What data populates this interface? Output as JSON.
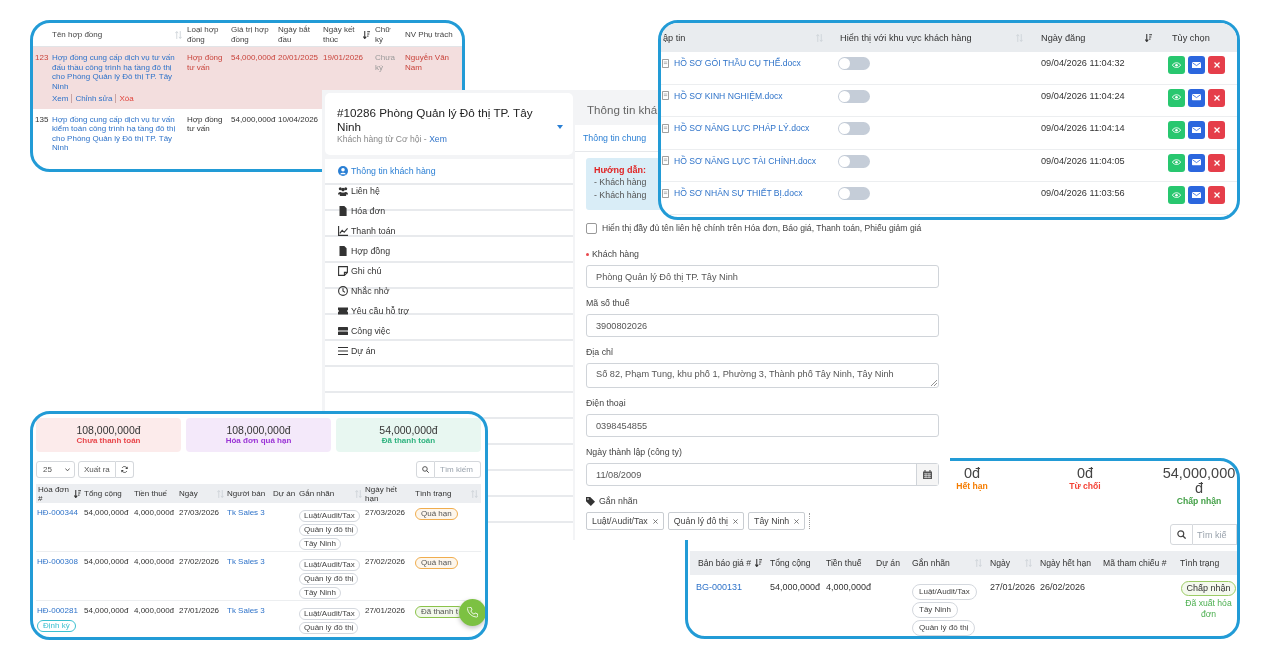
{
  "contracts_card": {
    "columns": [
      {
        "label": "Tên hợp đồng",
        "sortable": true,
        "sorted": false
      },
      {
        "label": "Loại hợp đồng",
        "sortable": false,
        "sorted": false
      },
      {
        "label": "Giá trị hợp đồng",
        "sortable": false,
        "sorted": false
      },
      {
        "label": "Ngày bắt đầu",
        "sortable": false,
        "sorted": false
      },
      {
        "label": "Ngày kết thúc",
        "sortable": true,
        "sorted": true
      },
      {
        "label": "Chữ ký",
        "sortable": false,
        "sorted": false
      },
      {
        "label": "NV Phụ trách",
        "sortable": false,
        "sorted": false
      }
    ],
    "rows": [
      {
        "highlighted": true,
        "number": "123",
        "name": "Hợp đồng cung cấp dịch vụ tư vấn đấu thầu công trình hạ tầng đô thị cho Phòng Quản lý Đô thị TP. Tây Ninh",
        "actions": [
          {
            "label": "Xem",
            "danger": false
          },
          {
            "label": "Chỉnh sửa",
            "danger": false
          },
          {
            "label": "Xóa",
            "danger": true
          }
        ],
        "type": "Hợp đồng tư vấn",
        "value": "54,000,000đ",
        "start": "20/01/2025",
        "end": "19/01/2026",
        "signature": "Chưa ký",
        "owner": "Nguyễn Văn Nam"
      },
      {
        "highlighted": false,
        "number": "135",
        "name": "Hợp đồng cung cấp dịch vụ tư vấn kiểm toán công trình hạ tầng đô thị cho Phòng Quản lý Đô thị TP. Tây Ninh",
        "type": "Hợp đồng tư vấn",
        "value": "54,000,000đ",
        "start": "10/04/2026"
      }
    ]
  },
  "customer_panel": {
    "title": "#10286 Phòng Quản lý Đô thị TP. Tây Ninh",
    "subtitle": "Khách hàng từ Cơ hội -",
    "subtitle_link": "Xem",
    "menu": [
      {
        "label": "Thông tin khách hàng",
        "selected": true
      },
      {
        "label": "Liên hệ",
        "selected": false
      },
      {
        "label": "Hóa đơn",
        "selected": false
      },
      {
        "label": "Thanh toán",
        "selected": false
      },
      {
        "label": "Hợp đồng",
        "selected": false
      },
      {
        "label": "Ghi chú",
        "selected": false
      },
      {
        "label": "Nhắc nhở",
        "selected": false
      },
      {
        "label": "Yêu cầu hỗ trợ",
        "selected": false
      },
      {
        "label": "Công việc",
        "selected": false
      },
      {
        "label": "Dự án",
        "selected": false
      }
    ]
  },
  "details": {
    "heading": "Thông tin khá",
    "tabs": [
      {
        "label": "Thông tin chung",
        "selected": true
      }
    ],
    "guide": {
      "title": "Hướng dẫn:",
      "lines": [
        "- Khách hàng",
        "- Khách hàng"
      ]
    },
    "show_full_contact": {
      "label": "Hiển thị đầy đủ tên liên hệ chính trên Hóa đơn, Báo giá, Thanh toán, Phiếu giảm giá",
      "checked": false
    },
    "fields": [
      {
        "label": "Khách hàng",
        "required": true,
        "kind": "input",
        "value": "Phòng Quản lý Đô thị TP. Tây Ninh"
      },
      {
        "label": "Mã số thuế",
        "required": false,
        "kind": "input",
        "value": "3900802026"
      },
      {
        "label": "Địa chỉ",
        "required": false,
        "kind": "textarea",
        "value": "Số 82, Phạm Tung, khu phố 1, Phường 3, Thành phố Tây Ninh, Tây Ninh"
      },
      {
        "label": "Điện thoại",
        "required": false,
        "kind": "input",
        "value": "0398454855"
      },
      {
        "label": "Ngày thành lập (công ty)",
        "required": false,
        "kind": "date",
        "value": "11/08/2009"
      }
    ],
    "tags_label": "Gắn nhãn",
    "tags": [
      "Luật/Audit/Tax",
      "Quản lý đô thị",
      "Tây Ninh"
    ]
  },
  "files_card": {
    "columns": [
      {
        "label": "ập tin",
        "sortable": true,
        "sorted": false
      },
      {
        "label": "Hiển thị với khu vực khách hàng",
        "sortable": true,
        "sorted": false
      },
      {
        "label": "Ngày đăng",
        "sortable": true,
        "sorted": true
      },
      {
        "label": "Tùy chọn",
        "sortable": false,
        "sorted": false
      }
    ],
    "rows": [
      {
        "name": "HỒ SƠ GÓI THẦU CỤ THỂ.docx",
        "visible_to_customer": false,
        "date": "09/04/2026 11:04:32"
      },
      {
        "name": "HỒ SƠ KINH NGHIỆM.docx",
        "visible_to_customer": false,
        "date": "09/04/2026 11:04:24"
      },
      {
        "name": "HỒ SƠ NĂNG LỰC PHÁP LÝ.docx",
        "visible_to_customer": false,
        "date": "09/04/2026 11:04:14"
      },
      {
        "name": "HỒ SƠ NĂNG LỰC TÀI CHÍNH.docx",
        "visible_to_customer": false,
        "date": "09/04/2026 11:04:05"
      },
      {
        "name": "HỒ SƠ NHÂN SỰ THIẾT BỊ.docx",
        "visible_to_customer": false,
        "date": "09/04/2026 11:03:56"
      }
    ]
  },
  "invoices_card": {
    "summary": [
      {
        "amount": "108,000,000đ",
        "label": "Chưa thanh toán",
        "color": "#e8474c"
      },
      {
        "amount": "108,000,000đ",
        "label": "Hóa đơn quá hạn",
        "color": "#9b35d6"
      },
      {
        "amount": "54,000,000đ",
        "label": "Đã thanh toán",
        "color": "#2fb37f"
      }
    ],
    "page_size": "25",
    "export_label": "Xuất ra",
    "search": {
      "placeholder": "Tìm kiếm"
    },
    "columns": [
      {
        "label": "Hóa đơn #",
        "sortable": true,
        "sorted": true
      },
      {
        "label": "Tổng cộng",
        "sortable": false,
        "sorted": false
      },
      {
        "label": "Tiền thuế",
        "sortable": false,
        "sorted": false
      },
      {
        "label": "Ngày",
        "sortable": true,
        "sorted": false
      },
      {
        "label": "Người bán",
        "sortable": false,
        "sorted": false
      },
      {
        "label": "Dự án",
        "sortable": false,
        "sorted": false
      },
      {
        "label": "Gắn nhãn",
        "sortable": true,
        "sorted": false
      },
      {
        "label": "Ngày hết hạn",
        "sortable": false,
        "sorted": false
      },
      {
        "label": "Tình trạng",
        "sortable": true,
        "sorted": false
      }
    ],
    "rows": [
      {
        "number": "HĐ-000344",
        "total": "54,000,000đ",
        "tax": "4,000,000đ",
        "date": "27/03/2026",
        "seller": "Tk Sales 3",
        "tags": [
          "Luật/Audit/Tax",
          "Quản lý đô thị",
          "Tây Ninh"
        ],
        "due": "27/03/2026",
        "status": {
          "label": "Quá hạn",
          "color": "#f0ad4e"
        }
      },
      {
        "number": "HĐ-000308",
        "total": "54,000,000đ",
        "tax": "4,000,000đ",
        "date": "27/02/2026",
        "seller": "Tk Sales 3",
        "tags": [
          "Luật/Audit/Tax",
          "Quản lý đô thị",
          "Tây Ninh"
        ],
        "due": "27/02/2026",
        "status": {
          "label": "Quá hạn",
          "color": "#f0ad4e"
        }
      },
      {
        "number": "HĐ-000281",
        "badge": "Định kỳ",
        "total": "54,000,000đ",
        "tax": "4,000,000đ",
        "date": "27/01/2026",
        "seller": "Tk Sales 3",
        "tags": [
          "Luật/Audit/Tax",
          "Quản lý đô thị"
        ],
        "due": "27/01/2026",
        "status": {
          "label": "Đã thanh t",
          "color": "#8bc34a"
        }
      }
    ]
  },
  "quotes_card": {
    "summary": [
      {
        "amount": "0đ",
        "label": "Hết hạn",
        "color": "#f57c00"
      },
      {
        "amount": "0đ",
        "label": "Từ chối",
        "color": "#f44336"
      },
      {
        "amount": "54,000,000đ",
        "label": "Chấp nhận",
        "color": "#43a047"
      }
    ],
    "search": {
      "placeholder": "Tìm kiế"
    },
    "columns": [
      {
        "label": "Bản báo giá #",
        "sortable": true,
        "sorted": true
      },
      {
        "label": "Tổng cộng",
        "sortable": false,
        "sorted": false
      },
      {
        "label": "Tiền thuế",
        "sortable": false,
        "sorted": false
      },
      {
        "label": "Dự án",
        "sortable": false,
        "sorted": false
      },
      {
        "label": "Gắn nhãn",
        "sortable": true,
        "sorted": false
      },
      {
        "label": "Ngày",
        "sortable": true,
        "sorted": false
      },
      {
        "label": "Ngày hết hạn",
        "sortable": false,
        "sorted": false
      },
      {
        "label": "Mã tham chiếu #",
        "sortable": false,
        "sorted": false
      },
      {
        "label": "Tình trạng",
        "sortable": false,
        "sorted": false
      }
    ],
    "rows": [
      {
        "number": "BG-000131",
        "total": "54,000,000đ",
        "tax": "4,000,000đ",
        "tags": [
          "Luật/Audit/Tax",
          "Tây Ninh",
          "Quản lý đô thị"
        ],
        "date": "27/01/2026",
        "due": "26/02/2026",
        "status": {
          "label": "Chấp nhận",
          "color": "#9ccc65"
        },
        "note": "Đã xuất hóa đơn"
      }
    ]
  }
}
